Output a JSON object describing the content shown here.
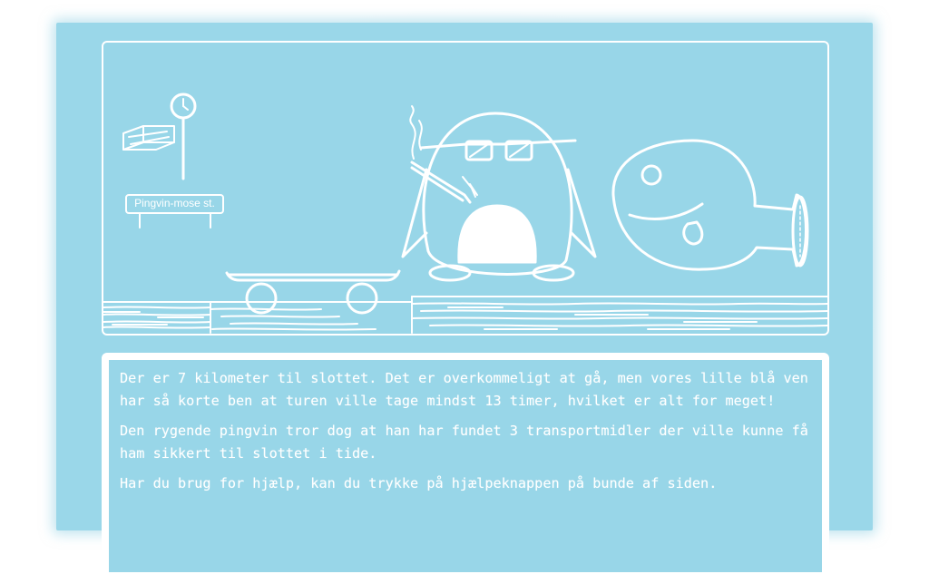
{
  "scene": {
    "sign_text": "Pingvin-mose st."
  },
  "story": {
    "paragraphs": [
      "Der er 7 kilometer til slottet. Det er overkommeligt at gå, men vores lille blå ven har så korte ben at turen ville tage mindst 13 timer, hvilket er alt for meget!",
      "Den rygende pingvin tror dog at han har fundet 3 transportmidler der ville kunne få ham sikkert til slottet i tide.",
      "Har du brug for hjælp, kan du trykke på hjælpeknappen på bunde af siden."
    ]
  },
  "colors": {
    "background": "#9ad7e9",
    "line": "#ffffff"
  },
  "icons": [
    "clock-icon",
    "bus-stop-sign",
    "skateboard",
    "penguin",
    "fish-cannon"
  ]
}
